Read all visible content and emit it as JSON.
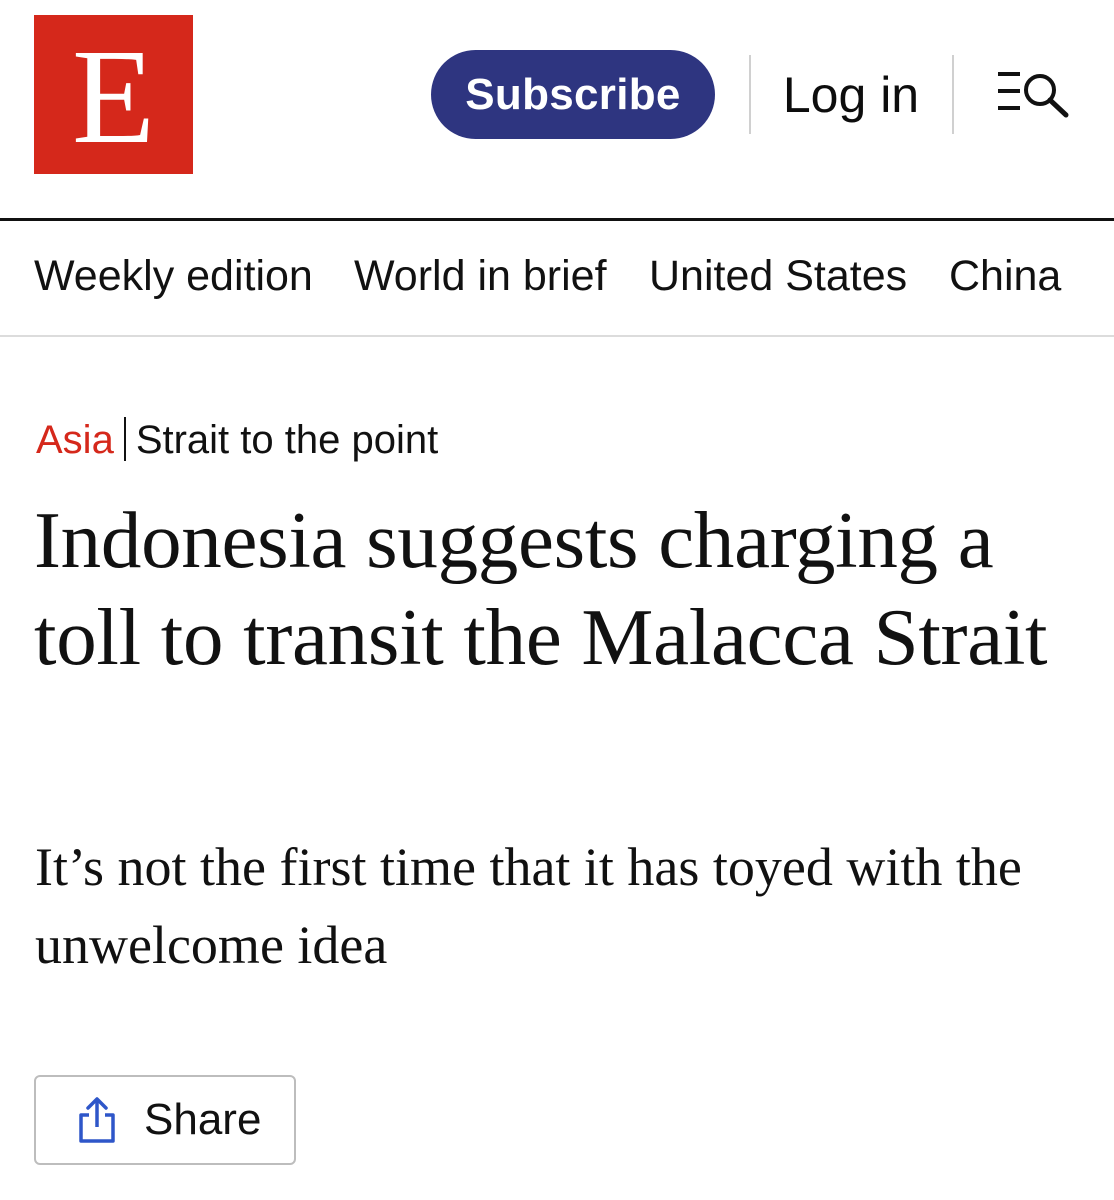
{
  "header": {
    "logo_letter": "E",
    "subscribe_label": "Subscribe",
    "login_label": "Log in",
    "menu_search_icon": "menu-search-icon",
    "colors": {
      "brand_red": "#d5281b",
      "subscribe_blue": "#2e3580"
    }
  },
  "nav": {
    "items": [
      {
        "label": "Weekly edition"
      },
      {
        "label": "World in brief"
      },
      {
        "label": "United States"
      },
      {
        "label": "China"
      }
    ]
  },
  "article": {
    "section": "Asia",
    "fly_title": "Strait to the point",
    "headline": "Indonesia suggests charging a toll to transit the Malacca Strait",
    "subheadline": "It’s not the first time that it has toyed with the unwelcome idea",
    "share_label": "Share",
    "share_icon": "share-icon"
  }
}
